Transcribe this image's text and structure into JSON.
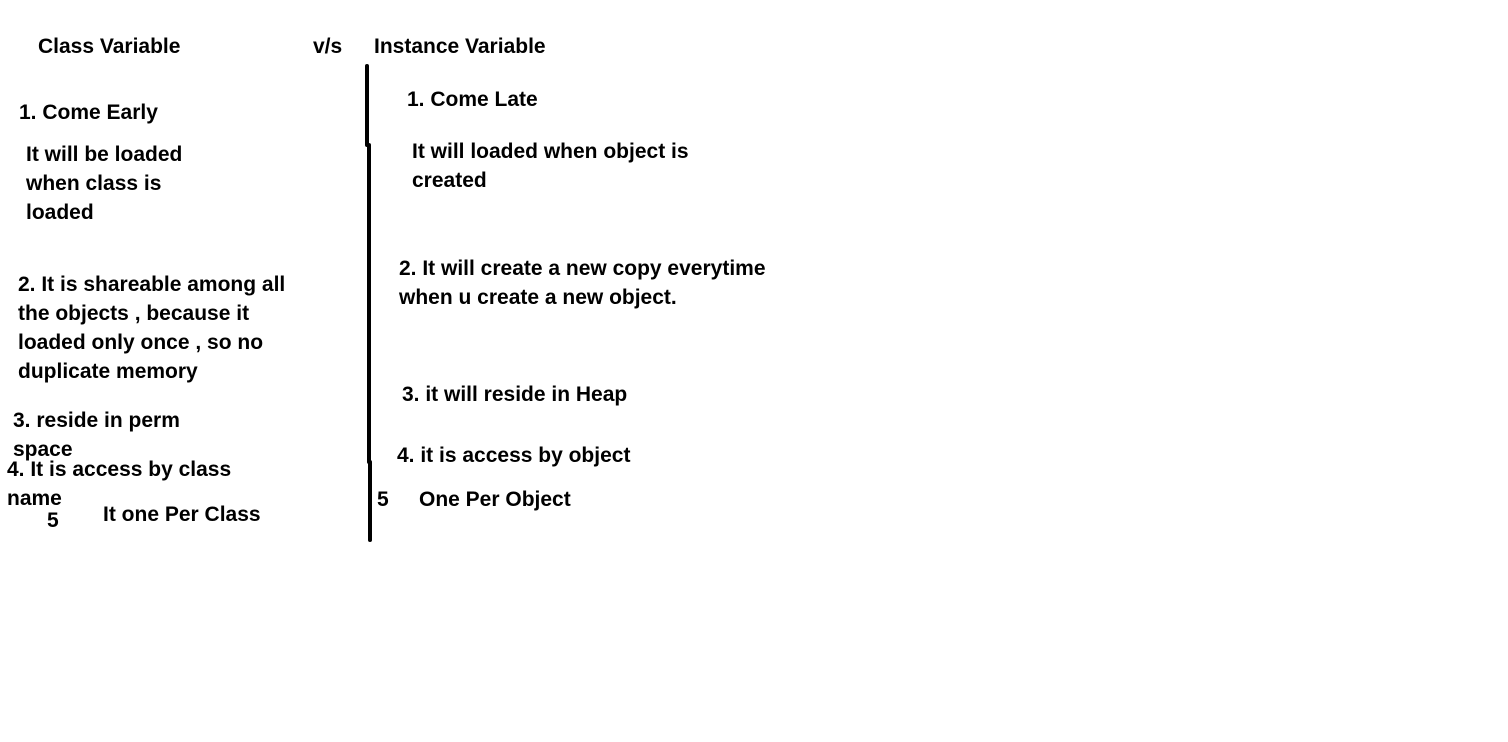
{
  "header": {
    "class_variable": "Class Variable",
    "vs": "v/s",
    "instance_variable": "Instance Variable"
  },
  "class_side": {
    "point1_title": "1. Come Early",
    "point1_detail": "It will be loaded\nwhen class is\nloaded",
    "point2": "2. It is shareable among all\nthe objects , because it\nloaded only once , so no\nduplicate memory",
    "point3": "3. reside in perm\nspace",
    "point4": "4. It is access by class\nname",
    "point5_number": "5",
    "point5_text": "It one Per Class"
  },
  "instance_side": {
    "point1_title": "1. Come Late",
    "point1_detail": "It will loaded when object is\ncreated",
    "point2": "2. It will create a new copy everytime\nwhen u create a new object.",
    "point3": "3. it will reside in Heap",
    "point4": "4. it is access by object",
    "point5_number": "5",
    "point5_text": "One Per Object"
  },
  "colors": {
    "background": "#ffffff",
    "ink": "#000000"
  }
}
